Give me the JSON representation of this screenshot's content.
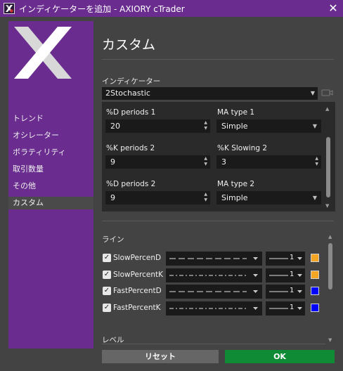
{
  "window": {
    "title": "インディケーターを追加 - AXIORY cTrader",
    "close_glyph": "✕"
  },
  "sidebar": {
    "items": [
      {
        "label": "トレンド"
      },
      {
        "label": "オシレーター"
      },
      {
        "label": "ボラティリティ"
      },
      {
        "label": "取引数量"
      },
      {
        "label": "その他"
      },
      {
        "label": "カスタム",
        "selected": true
      }
    ]
  },
  "main": {
    "title": "カスタム",
    "indicator_label": "インディケーター",
    "indicator_value": "2Stochastic"
  },
  "params": [
    {
      "label": "%D periods 1",
      "value": "20",
      "kind": "number"
    },
    {
      "label": "MA type 1",
      "value": "Simple",
      "kind": "select"
    },
    {
      "label": "%K periods 2",
      "value": "9",
      "kind": "number"
    },
    {
      "label": "%K Slowing 2",
      "value": "3",
      "kind": "number"
    },
    {
      "label": "%D periods 2",
      "value": "9",
      "kind": "number"
    },
    {
      "label": "MA type 2",
      "value": "Simple",
      "kind": "select"
    }
  ],
  "lines_section": {
    "title": "ライン",
    "rows": [
      {
        "name": "SlowPercenD",
        "checked": true,
        "style": "dashed",
        "width": "1",
        "color": "#f5a623"
      },
      {
        "name": "SlowPercentK",
        "checked": true,
        "style": "dash-dot",
        "width": "1",
        "color": "#f5a623"
      },
      {
        "name": "FastPercentD",
        "checked": true,
        "style": "dashed",
        "width": "1",
        "color": "#0000ff"
      },
      {
        "name": "FastPercentK",
        "checked": true,
        "style": "dash-dot",
        "width": "1",
        "color": "#0000ff"
      }
    ]
  },
  "levels_section": {
    "title": "レベル"
  },
  "buttons": {
    "reset": "リセット",
    "ok": "OK"
  },
  "colors": {
    "accent": "#6a2d8f",
    "ok_button": "#0f8a35",
    "reset_button": "#666666"
  }
}
